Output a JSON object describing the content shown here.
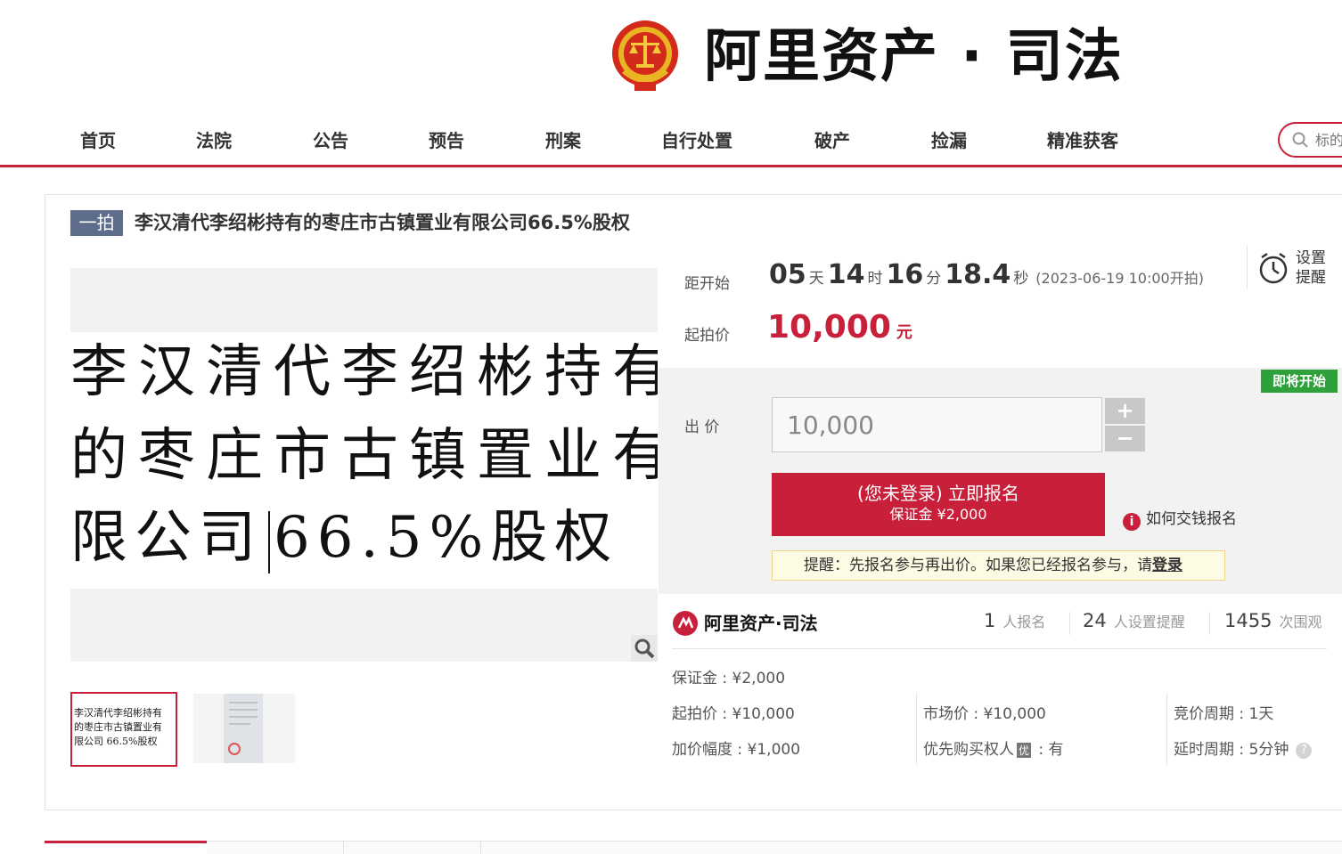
{
  "brand": {
    "logo_text": "阿里资产 · 司法",
    "emblem": "court-emblem-icon"
  },
  "nav": {
    "items": [
      {
        "label": "首页"
      },
      {
        "label": "法院"
      },
      {
        "label": "公告"
      },
      {
        "label": "预告"
      },
      {
        "label": "刑案"
      },
      {
        "label": "自行处置"
      },
      {
        "label": "破产"
      },
      {
        "label": "捡漏"
      },
      {
        "label": "精准获客"
      }
    ],
    "search_placeholder": "标的"
  },
  "item": {
    "round": "一拍",
    "title": "李汉清代李绍彬持有的枣庄市古镇置业有限公司66.5%股权",
    "image_text_lines": [
      "李汉清代李绍彬持有",
      "的枣庄市古镇置业有",
      "限公司",
      "66.5%股权"
    ],
    "thumb_text_lines": [
      "李汉清代李绍彬持有",
      "的枣庄市古镇置业有",
      "限公司 66.5%股权"
    ]
  },
  "countdown": {
    "label": "距开始",
    "days": "05",
    "days_unit": "天",
    "hours": "14",
    "hours_unit": "时",
    "minutes": "16",
    "minutes_unit": "分",
    "seconds": "18.4",
    "seconds_unit": "秒",
    "start_time": "(2023-06-19 10:00开拍)"
  },
  "reminder": {
    "label": "设置提醒"
  },
  "start_price": {
    "label": "起拍价",
    "value": "10,000",
    "unit": "元"
  },
  "bid": {
    "status_badge": "即将开始",
    "label": "出 价",
    "value": "10,000",
    "plus": "+",
    "minus": "−",
    "signup_main": "(您未登录) 立即报名",
    "signup_sub": "保证金 ¥2,000",
    "howto": "如何交钱报名",
    "notice_prefix": "提醒：先报名参与再出价。如果您已经报名参与，请",
    "notice_link": "登录"
  },
  "stats": {
    "brand_name": "阿里资产·司法",
    "signups": "1",
    "signups_label": "人报名",
    "reminders": "24",
    "reminders_label": "人设置提醒",
    "views": "1455",
    "views_label": "次围观"
  },
  "details": {
    "deposit": "保证金 : ¥2,000",
    "start_price": "起拍价 : ¥10,000",
    "increment": "加价幅度 : ¥1,000",
    "market_price": "市场价 : ¥10,000",
    "priority_prefix": "优先购买权人",
    "priority_badge": "优",
    "priority_value": " : 有",
    "bid_period": "竞价周期 : 1天",
    "delay_period": "延时周期 : 5分钟"
  },
  "colors": {
    "accent": "#c8203a",
    "badge_green": "#2ea13b",
    "round_badge": "#5f6d8c"
  }
}
